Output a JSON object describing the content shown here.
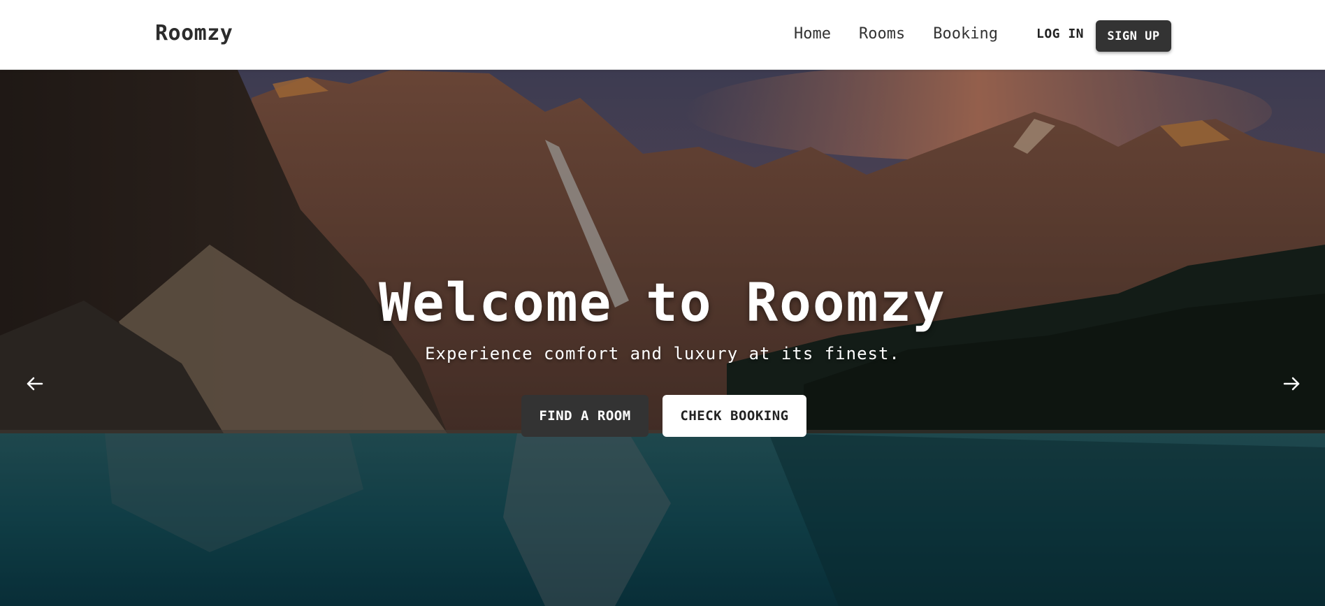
{
  "brand": {
    "name": "Roomzy"
  },
  "nav": {
    "links": [
      {
        "label": "Home"
      },
      {
        "label": "Rooms"
      },
      {
        "label": "Booking"
      }
    ],
    "login_label": "LOG IN",
    "signup_label": "SIGN UP"
  },
  "hero": {
    "title": "Welcome to Roomzy",
    "subtitle": "Experience comfort and luxury at its finest.",
    "primary_button": "FIND A ROOM",
    "secondary_button": "CHECK BOOKING",
    "prev_icon": "arrow-left-icon",
    "next_icon": "arrow-right-icon",
    "background": "mountain-lake-photo"
  },
  "colors": {
    "dark_button": "#333333",
    "light_button": "#ffffff",
    "navbar_bg": "#ffffff"
  }
}
